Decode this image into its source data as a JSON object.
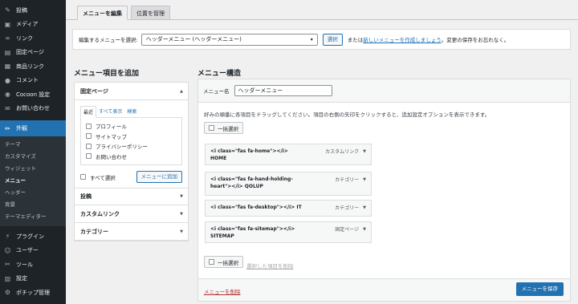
{
  "sidebar": {
    "top_items": [
      {
        "icon": "pin-icon",
        "glyph": "✎",
        "label": "投稿"
      },
      {
        "icon": "media-icon",
        "glyph": "▣",
        "label": "メディア"
      },
      {
        "icon": "link-icon",
        "glyph": "∞",
        "label": "リンク"
      },
      {
        "icon": "page-icon",
        "glyph": "▤",
        "label": "固定ページ"
      },
      {
        "icon": "product-link-icon",
        "glyph": "▦",
        "label": "商品リンク"
      },
      {
        "icon": "comment-icon",
        "glyph": "●",
        "label": "コメント"
      },
      {
        "icon": "cocoon-icon",
        "glyph": "◉",
        "label": "Cocoon 設定"
      },
      {
        "icon": "contact-icon",
        "glyph": "✉",
        "label": "お問い合わせ"
      }
    ],
    "active_item": {
      "icon": "appearance-icon",
      "glyph": "✏",
      "label": "外観"
    },
    "sub_items": [
      "テーマ",
      "カスタマイズ",
      "ウィジェット",
      "メニュー",
      "ヘッダー",
      "背景",
      "テーマエディター"
    ],
    "current_sub": "メニュー",
    "bottom_items": [
      {
        "icon": "plugin-icon",
        "glyph": "⚡",
        "label": "プラグイン"
      },
      {
        "icon": "users-icon",
        "glyph": "☺",
        "label": "ユーザー"
      },
      {
        "icon": "tools-icon",
        "glyph": "✂",
        "label": "ツール"
      },
      {
        "icon": "settings-icon",
        "glyph": "▥",
        "label": "設定"
      },
      {
        "icon": "popup-icon",
        "glyph": "⚙",
        "label": "ポチップ管理"
      }
    ]
  },
  "tabs": {
    "edit": "メニューを編集",
    "locations": "位置を管理"
  },
  "select_bar": {
    "label": "編集するメニューを選択:",
    "selected": "ヘッダーメニュー (ヘッダーメニュー)",
    "select_button": "選択",
    "or_text": "または",
    "create_link": "新しいメニューを作成しましょう",
    "suffix": "。変更の保存をお忘れなく。"
  },
  "left": {
    "heading": "メニュー項目を追加",
    "pages_header": "固定ページ",
    "subtabs": [
      "最近",
      "すべて表示",
      "検索"
    ],
    "pages": [
      "プロフィール",
      "サイトマップ",
      "プライバシーポリシー",
      "お問い合わせ"
    ],
    "select_all": "すべて選択",
    "add_button": "メニューに追加",
    "sections": [
      "投稿",
      "カスタムリンク",
      "カテゴリー"
    ]
  },
  "right": {
    "heading": "メニュー構造",
    "name_label": "メニュー名",
    "name_value": "ヘッダーメニュー",
    "instructions": "好みの順番に各項目をドラッグしてください。項目の右側の矢印をクリックすると、追加設定オプションを表示できます。",
    "bulk_select": "一括選択",
    "items": [
      {
        "line1": "<i class=\"fas fa-home\"></i>",
        "line2": "HOME",
        "type": "カスタムリンク"
      },
      {
        "line1": "<i class=\"fas fa-hand-holding-",
        "line2": "heart\"></i> QOLUP",
        "type": "カテゴリー"
      },
      {
        "line1": "<i class=\"fas fa-desktop\"></i> IT",
        "line2": "",
        "type": "カテゴリー"
      },
      {
        "line1": "<i class=\"fas fa-sitemap\"></i>",
        "line2": "SITEMAP",
        "type": "固定ページ"
      }
    ],
    "delete_selected": "選択した項目を削除",
    "delete_menu": "メニューを削除",
    "save_button": "メニューを保存"
  },
  "colors": {
    "sidebar_bg": "#1d2327",
    "accent": "#2271b1",
    "danger": "#b32d2e"
  }
}
